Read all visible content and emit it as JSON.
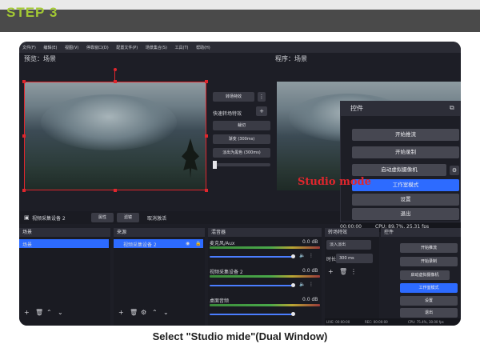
{
  "step": {
    "label": "STEP 3"
  },
  "menu": [
    "文件(F)",
    "编辑(E)",
    "视图(V)",
    "停靠窗口(D)",
    "配置文件(P)",
    "场景集合(S)",
    "工具(T)",
    "帮助(H)"
  ],
  "preview": {
    "left_label": "预览：场景",
    "right_label": "程序：场景"
  },
  "transition": {
    "button": "转场特效",
    "quick_label": "快速转场特效",
    "options": [
      "裁切",
      "渐变 (300ms)",
      "淡出为黑色 (300ms)"
    ]
  },
  "source_bar": {
    "name": "视频采集设备 2",
    "properties": "属性",
    "filters": "滤镜",
    "deactivate": "取消激活"
  },
  "scenes": {
    "header": "场景",
    "items": [
      "场景"
    ]
  },
  "sources": {
    "header": "来源",
    "items": [
      "视频采集设备 2"
    ]
  },
  "mixer": {
    "header": "混音器",
    "tracks": [
      {
        "name": "麦克风/Aux",
        "db": "0.0 dB",
        "scale": [
          "-60",
          "-55",
          "-50",
          "-45",
          "-40",
          "-35",
          "-30",
          "-25",
          "-20",
          "-15",
          "-10",
          "-5",
          "0"
        ]
      },
      {
        "name": "视频采集设备 2",
        "db": "0.0 dB",
        "scale": [
          "-60",
          "-55",
          "-50",
          "-45",
          "-40",
          "-35",
          "-30",
          "-25",
          "-20",
          "-15",
          "-10",
          "-5",
          "0"
        ]
      },
      {
        "name": "桌面音频",
        "db": "0.0 dB",
        "scale": [
          "-60",
          "-55",
          "-50",
          "-45",
          "-40",
          "-35",
          "-30",
          "-25",
          "-20",
          "-15",
          "-10",
          "-5",
          "0"
        ]
      }
    ]
  },
  "transitions_panel": {
    "header": "转场特效",
    "effect": "淡入淡出",
    "duration_label": "时长",
    "duration": "300 ms"
  },
  "controls_popup": {
    "header": "控件",
    "buttons": [
      "开始推流",
      "开始录制",
      "启动虚拟摄像机",
      "工作室模式",
      "设置",
      "退出"
    ],
    "status_time": "00:00:00",
    "status_cpu": "CPU: 89.7%, 25.31 fps"
  },
  "controls_small": {
    "header": "控件",
    "buttons": [
      "开始推流",
      "开始录制",
      "启动虚拟摄像机",
      "工作室模式",
      "设置",
      "退出"
    ]
  },
  "status_bar": {
    "live": "LIVE: 00:00:00",
    "rec": "REC: 00:00:00",
    "cpu": "CPU: 75.4%, 30.00 fps"
  },
  "annotation": {
    "text": "Studio mode",
    "color": "#e0262d"
  },
  "caption": "Select \"Studio mide\"(Dual Window)",
  "colors": {
    "accent": "#a3c933",
    "highlight": "#2d6bff",
    "selection_red": "#e0262d"
  },
  "icons": [
    "gear-icon",
    "plus-icon",
    "trash-icon",
    "up-icon",
    "down-icon",
    "eye-icon",
    "lock-icon",
    "menu-dots-icon",
    "camera-icon"
  ]
}
